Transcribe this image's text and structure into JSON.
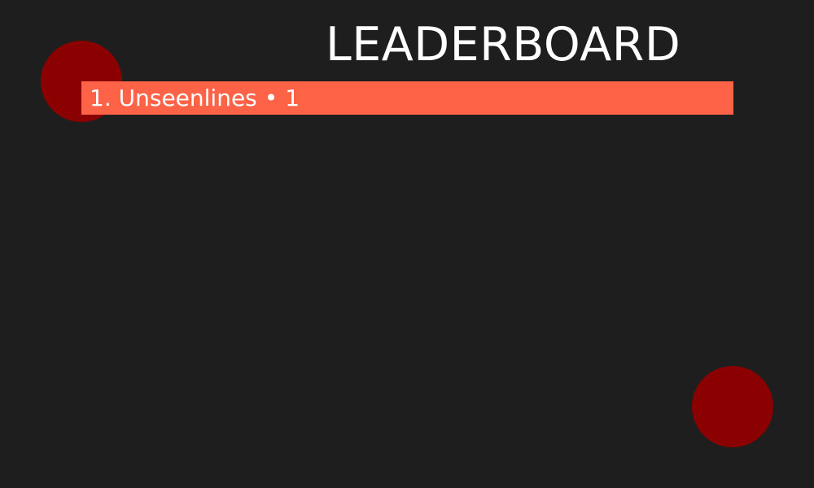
{
  "colors": {
    "background": "#1e1e1e",
    "decoration": "#8b0000",
    "row_highlight": "#ff6347",
    "text": "#ffffff"
  },
  "decorations": [
    {
      "name": "circle-top-left"
    },
    {
      "name": "circle-bottom-right"
    }
  ],
  "leaderboard": {
    "title": "LEADERBOARD",
    "entries": [
      {
        "rank": "1.",
        "player": "Unseenlines",
        "separator": "•",
        "score": "1"
      }
    ]
  }
}
